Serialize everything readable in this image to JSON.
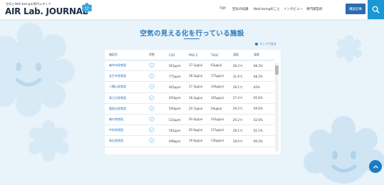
{
  "header": {
    "tagline": "空気とWell-beingの専門メディア",
    "logo": "AIR Lab. JOURNAL",
    "nav": [
      "TOP",
      "空気の知識",
      "Well-beingのこと",
      "インタビュー",
      "専門家監修"
    ],
    "cta": "購読記事"
  },
  "section": {
    "title": "空気の見える化を行っている施設",
    "map_link": "マップで見る"
  },
  "table": {
    "headers": [
      "施設名",
      "状態",
      "CO2",
      "PM2.5",
      "TVOC",
      "温度",
      "湿度"
    ],
    "rows": [
      {
        "name": "麻布寺保育園",
        "co2": "561ppm",
        "pm": "17.1μg/㎥",
        "tvoc": "63μg/㎥",
        "temp": "28.2℃",
        "hum": "68.2%"
      },
      {
        "name": "金生寺保育園",
        "co2": "775ppm",
        "pm": "18.5μg/㎥",
        "tvoc": "175μg/㎥",
        "temp": "31.6℃",
        "hum": "68.2%"
      },
      {
        "name": "八幡山保育園",
        "co2": "465ppm",
        "pm": "17.3μg/㎥",
        "tvoc": "144μg/㎥",
        "temp": "28.1℃",
        "hum": "83%"
      },
      {
        "name": "高之台保育園",
        "co2": "450ppm",
        "pm": "18.2μg/㎥",
        "tvoc": "165μg/㎥",
        "temp": "27.4℃",
        "hum": "65.6%"
      },
      {
        "name": "鹿島沢保育園",
        "co2": "500ppm",
        "pm": "20.7μg/㎥",
        "tvoc": "29μg/㎥",
        "temp": "29.2℃",
        "hum": "69.6%"
      },
      {
        "name": "森の保育園",
        "co2": "532ppm",
        "pm": "20.4μg/㎥",
        "tvoc": "141μg/㎥",
        "temp": "29.2℃",
        "hum": "62.6%"
      },
      {
        "name": "中町保育園",
        "co2": "581ppm",
        "pm": "20.6μg/㎥",
        "tvoc": "115μg/㎥",
        "temp": "28.1℃",
        "hum": "65.1%"
      },
      {
        "name": "高石保育園",
        "co2": "498ppm",
        "pm": "19.6μg/㎥",
        "tvoc": "130μg/㎥",
        "temp": "28.6℃",
        "hum": "66.0%"
      }
    ]
  },
  "colors": {
    "accent": "#1b97d4",
    "nav_button": "#2b6cb0",
    "link": "#1a73c9",
    "background": "#e9f3fa"
  },
  "icons": [
    "cloud-logo-icon",
    "search-icon",
    "smile-face-icon",
    "arrow-up-icon",
    "map-pin-icon"
  ]
}
